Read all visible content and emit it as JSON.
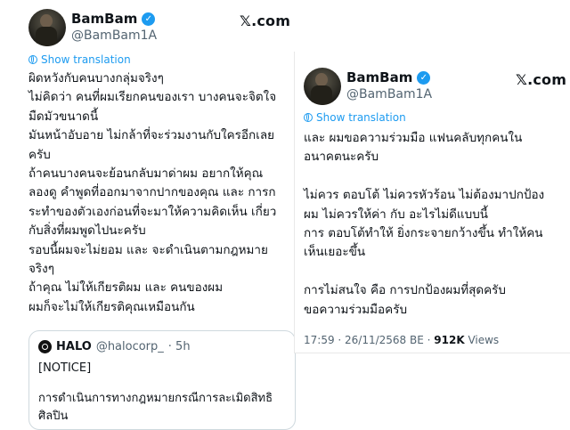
{
  "left_post": {
    "author": {
      "display_name": "BamBam",
      "handle": "@BamBam1A"
    },
    "brand": "𝕏.com",
    "show_translation": "Show translation",
    "lines": [
      "ผิดหวังกับคนบางกลุ่มจริงๆ",
      "ไม่คิดว่า คนที่ผมเรียกคนของเรา บางคนจะจิตใจ",
      "มืดมัวขนาดนี้",
      "มันหน้าอับอาย ไม่กล้าที่จะร่วมงานกับใครอีกเลย",
      "ครับ",
      "ถ้าคนบางคนจะย้อนกลับมาด่าผม อยากให้คุณ",
      "ลองดู คำพูดที่ออกมาจากปากของคุณ และ การก",
      "ระทำของตัวเองก่อนที่จะมาให้ความคิดเห็น เกี่ยว",
      "กับสิ่งที่ผมพูดไปนะครับ",
      "รอบนี้ผมจะไม่ยอม และ จะดำเนินตามกฎหมาย",
      "จริงๆ",
      "ถ้าคุณ ไม่ให้เกียรติผม และ คนของผม",
      "ผมก็จะไม่ให้เกียรติคุณเหมือนกัน"
    ],
    "quote": {
      "name": "HALO",
      "handle": "@halocorp_",
      "time": "· 5h",
      "lines": [
        "[NOTICE]",
        "การดำเนินการทางกฎหมายกรณีการละเมิดสิทธิ",
        "ศิลปิน"
      ]
    }
  },
  "right_post": {
    "author": {
      "display_name": "BamBam",
      "handle": "@BamBam1A"
    },
    "brand": "𝕏.com",
    "show_translation": "Show translation",
    "lines": [
      "และ ผมขอความร่วมมือ แฟนคลับทุกคนใน",
      "อนาคตนะครับ",
      "",
      "ไม่ควร ตอบโต้ ไม่ควรหัวร้อน ไม่ต้องมาปกป้อง",
      "ผม ไม่ควรให้ค่า กับ อะไรไม่ดีแบบนี้",
      "การ ตอบโต้ทำให้ ยิ่งกระจายกว้างขึ้น ทำให้คน",
      "เห็นเยอะขึ้น",
      "",
      "การไม่สนใจ คือ การปกป้องผมที่สุดครับ",
      "ขอความร่วมมือครับ"
    ],
    "timestamp": "17:59 · 26/11/2568 BE ·",
    "views_count": "912K",
    "views_label": " Views"
  },
  "colors": {
    "accent": "#1d9bf0",
    "text": "#0f1419",
    "muted": "#536471"
  },
  "icons": [
    "verified-badge-icon",
    "globe-icon",
    "halo-logo-icon"
  ]
}
